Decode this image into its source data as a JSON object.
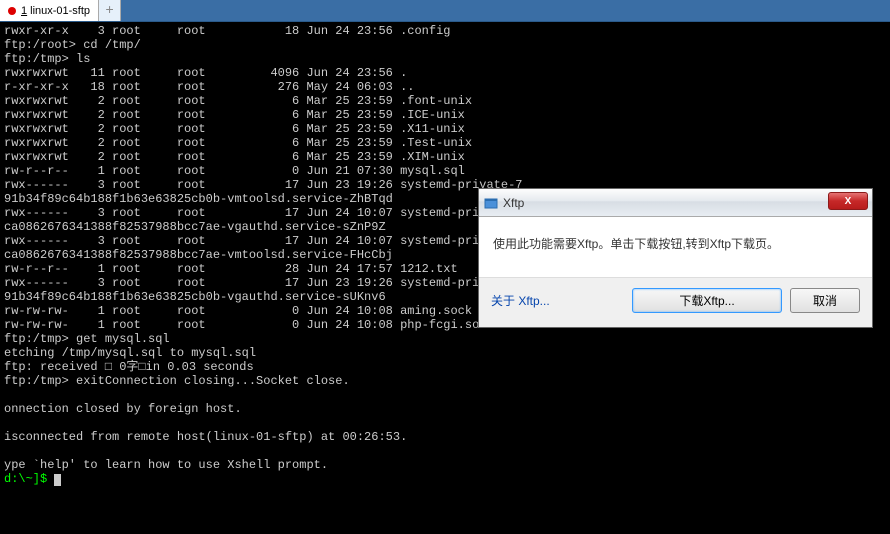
{
  "tab": {
    "number": "1",
    "label": "linux-01-sftp",
    "add": "+"
  },
  "terminal": {
    "lines": [
      "rwxr-xr-x    3 root     root           18 Jun 24 23:56 .config",
      "ftp:/root> cd /tmp/",
      "ftp:/tmp> ls",
      "rwxrwxrwt   11 root     root         4096 Jun 24 23:56 .",
      "r-xr-xr-x   18 root     root          276 May 24 06:03 ..",
      "rwxrwxrwt    2 root     root            6 Mar 25 23:59 .font-unix",
      "rwxrwxrwt    2 root     root            6 Mar 25 23:59 .ICE-unix",
      "rwxrwxrwt    2 root     root            6 Mar 25 23:59 .X11-unix",
      "rwxrwxrwt    2 root     root            6 Mar 25 23:59 .Test-unix",
      "rwxrwxrwt    2 root     root            6 Mar 25 23:59 .XIM-unix",
      "rw-r--r--    1 root     root            0 Jun 21 07:30 mysql.sql",
      "rwx------    3 root     root           17 Jun 23 19:26 systemd-private-7",
      "91b34f89c64b188f1b63e63825cb0b-vmtoolsd.service-ZhBTqd",
      "rwx------    3 root     root           17 Jun 24 10:07 systemd-private-7",
      "ca0862676341388f82537988bcc7ae-vgauthd.service-sZnP9Z",
      "rwx------    3 root     root           17 Jun 24 10:07 systemd-private-7",
      "ca0862676341388f82537988bcc7ae-vmtoolsd.service-FHcCbj",
      "rw-r--r--    1 root     root           28 Jun 24 17:57 1212.txt",
      "rwx------    3 root     root           17 Jun 23 19:26 systemd-private-7",
      "91b34f89c64b188f1b63e63825cb0b-vgauthd.service-sUKnv6",
      "rw-rw-rw-    1 root     root            0 Jun 24 10:08 aming.sock",
      "rw-rw-rw-    1 root     root            0 Jun 24 10:08 php-fcgi.sock",
      "ftp:/tmp> get mysql.sql",
      "etching /tmp/mysql.sql to mysql.sql",
      "ftp: received □ 0字□in 0.03 seconds",
      "ftp:/tmp> exitConnection closing...Socket close.",
      "",
      "onnection closed by foreign host.",
      "",
      "isconnected from remote host(linux-01-sftp) at 00:26:53.",
      "",
      "ype `help' to learn how to use Xshell prompt."
    ],
    "prompt_green": "d:\\~]$",
    "prompt_arrow": " "
  },
  "dialog": {
    "title": "Xftp",
    "message": "使用此功能需要Xftp。单击下载按钮,转到Xftp下载页。",
    "about_link": "关于 Xftp...",
    "download_btn": "下载Xftp...",
    "cancel_btn": "取消",
    "close": "X"
  }
}
